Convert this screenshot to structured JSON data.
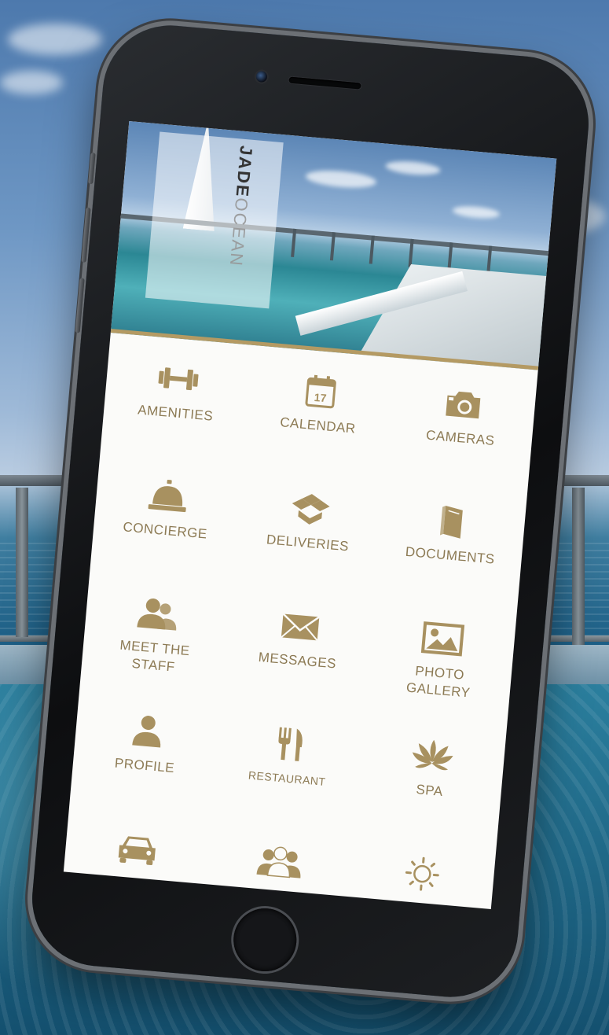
{
  "app": {
    "logo": {
      "line1": "JADE",
      "line2": "OCEAN"
    },
    "accent_color": "#a89160"
  },
  "menu": [
    {
      "id": "amenities",
      "label": "AMENITIES",
      "icon": "dumbbell-icon"
    },
    {
      "id": "calendar",
      "label": "CALENDAR",
      "icon": "calendar-icon",
      "badge": "17"
    },
    {
      "id": "cameras",
      "label": "CAMERAS",
      "icon": "camera-icon"
    },
    {
      "id": "concierge",
      "label": "CONCIERGE",
      "icon": "service-bell-icon"
    },
    {
      "id": "deliveries",
      "label": "DELIVERIES",
      "icon": "open-box-icon"
    },
    {
      "id": "documents",
      "label": "DOCUMENTS",
      "icon": "book-icon"
    },
    {
      "id": "meet-the-staff",
      "label": "MEET THE\nSTAFF",
      "icon": "people-icon"
    },
    {
      "id": "messages",
      "label": "MESSAGES",
      "icon": "envelope-icon"
    },
    {
      "id": "photo-gallery",
      "label": "PHOTO\nGALLERY",
      "icon": "picture-icon"
    },
    {
      "id": "profile",
      "label": "PROFILE",
      "icon": "person-icon"
    },
    {
      "id": "restaurant",
      "label": "RESTAURANT",
      "icon": "fork-knife-icon"
    },
    {
      "id": "spa",
      "label": "SPA",
      "icon": "lotus-icon"
    },
    {
      "id": "valet",
      "label": "",
      "icon": "car-icon"
    },
    {
      "id": "residents",
      "label": "",
      "icon": "group-icon"
    },
    {
      "id": "weather",
      "label": "",
      "icon": "sun-icon"
    }
  ]
}
